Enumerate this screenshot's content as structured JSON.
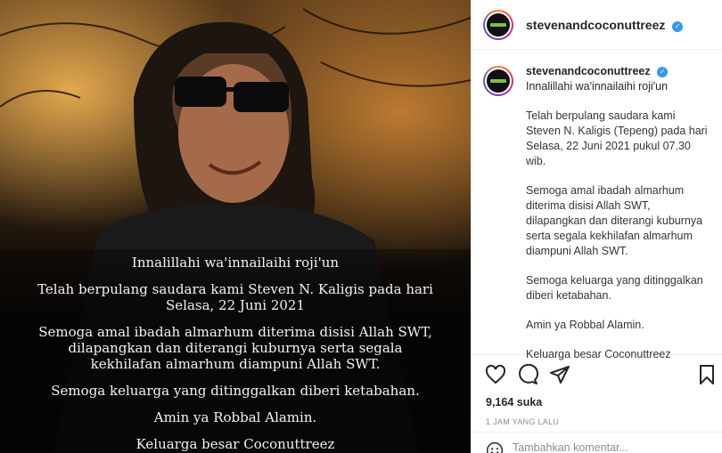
{
  "post": {
    "overlay": {
      "line1": "Innalillahi wa'innailaihi roji'un",
      "line2": "Telah berpulang saudara kami Steven N. Kaligis pada hari Selasa, 22 Juni 2021",
      "line3": "Semoga amal ibadah almarhum diterima disisi Allah SWT, dilapangkan dan diterangi kuburnya serta segala kekhilafan almarhum diampuni Allah SWT.",
      "line4": "Semoga keluarga yang ditinggalkan diberi ketabahan.",
      "line5": "Amin ya Robbal Alamin.",
      "line6": "Keluarga besar Coconuttreez"
    }
  },
  "sidebar": {
    "header": {
      "username": "stevenandcoconuttreez",
      "verified_symbol": "✓"
    },
    "caption": {
      "username": "stevenandcoconuttreez",
      "first": "Innalillahi wa'innailaihi roji'un",
      "p1": "Telah berpulang saudara kami Steven N. Kaligis (Tepeng) pada hari Selasa, 22 Juni 2021 pukul 07.30 wib.",
      "p2": "Semoga amal ibadah almarhum diterima disisi Allah SWT, dilapangkan dan diterangi kuburnya serta segala kekhilafan almarhum diampuni Allah SWT.",
      "p3": "Semoga keluarga yang ditinggalkan diberi ketabahan.",
      "p4": "Amin ya Robbal Alamin.",
      "p5": "Keluarga besar Coconuttreez"
    },
    "actions": {
      "like_icon": "heart-icon",
      "comment_icon": "comment-icon",
      "share_icon": "share-icon",
      "save_icon": "bookmark-icon"
    },
    "likes": "9,164 suka",
    "time": "1 JAM YANG LALU",
    "add_comment": {
      "placeholder": "Tambahkan komentar...",
      "emoji_icon": "emoji-icon"
    }
  },
  "colors": {
    "verified": "#3897f0",
    "text": "#262626",
    "muted": "#8e8e8e",
    "border": "#efefef"
  }
}
